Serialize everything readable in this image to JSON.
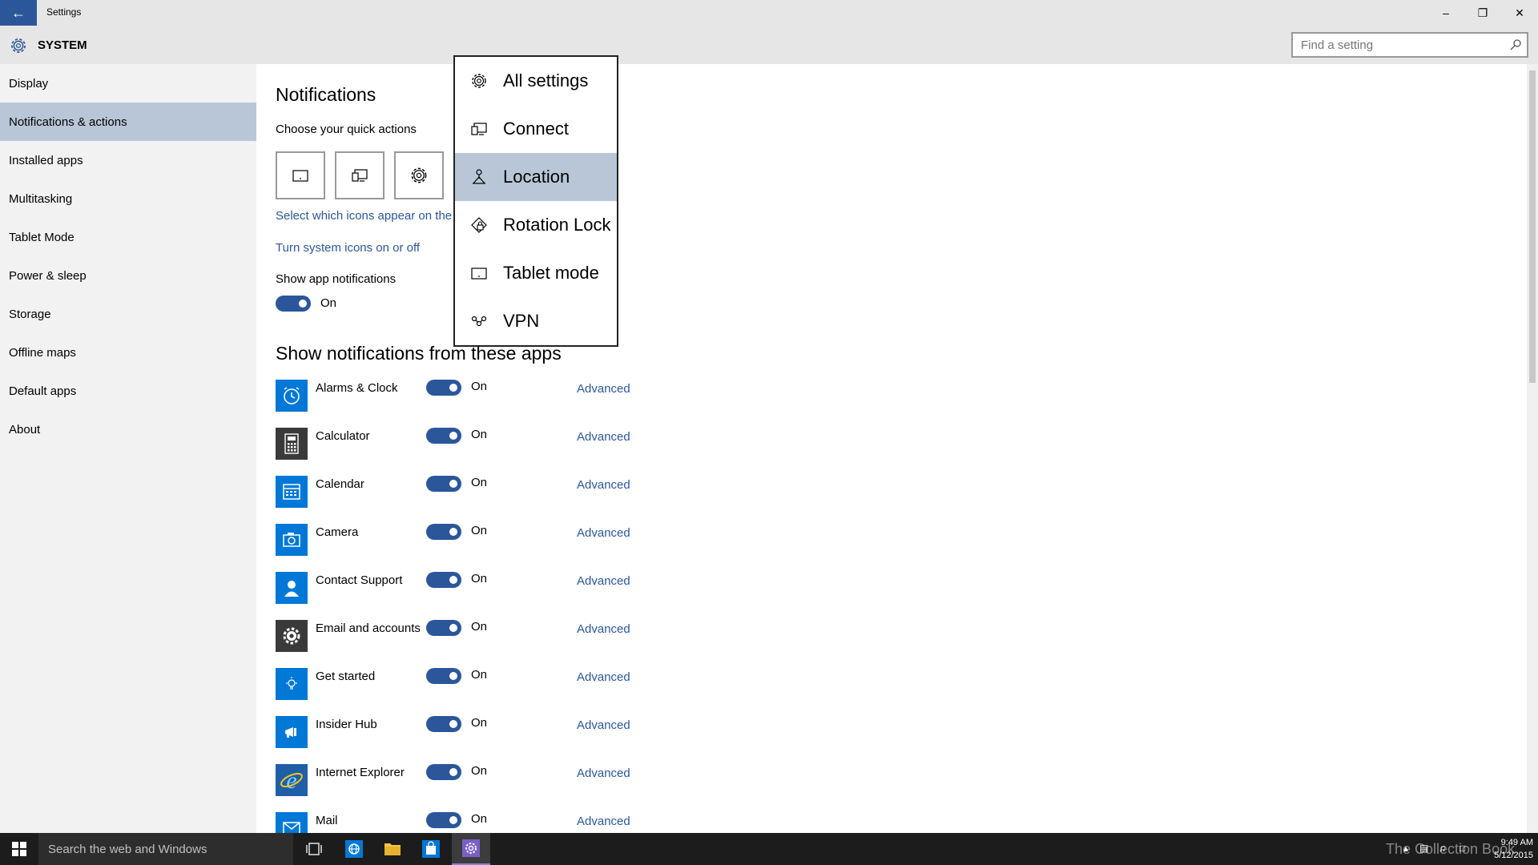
{
  "window": {
    "title": "Settings",
    "controls": {
      "minimize": "–",
      "restore": "❐",
      "close": "✕"
    }
  },
  "header": {
    "section": "SYSTEM",
    "search_placeholder": "Find a setting"
  },
  "sidebar": {
    "items": [
      {
        "label": "Display"
      },
      {
        "label": "Notifications & actions",
        "selected": true
      },
      {
        "label": "Installed apps"
      },
      {
        "label": "Multitasking"
      },
      {
        "label": "Tablet Mode"
      },
      {
        "label": "Power & sleep"
      },
      {
        "label": "Storage"
      },
      {
        "label": "Offline maps"
      },
      {
        "label": "Default apps"
      },
      {
        "label": "About"
      }
    ]
  },
  "main": {
    "title": "Notifications",
    "quick_actions_label": "Choose your quick actions",
    "quick_action_icons": [
      "tablet-icon",
      "connect-icon",
      "gear-icon"
    ],
    "select_icons_link": "Select which icons appear on the",
    "system_icons_link": "Turn system icons on or off",
    "show_app_notifications_label": "Show app notifications",
    "show_app_notifications_state": "On",
    "apps_header": "Show notifications from these apps",
    "apps": [
      {
        "name": "Alarms & Clock",
        "state": "On",
        "advanced": "Advanced",
        "icon": "alarm-clock-icon"
      },
      {
        "name": "Calculator",
        "state": "On",
        "advanced": "Advanced",
        "icon": "calculator-icon"
      },
      {
        "name": "Calendar",
        "state": "On",
        "advanced": "Advanced",
        "icon": "calendar-icon"
      },
      {
        "name": "Camera",
        "state": "On",
        "advanced": "Advanced",
        "icon": "camera-icon"
      },
      {
        "name": "Contact Support",
        "state": "On",
        "advanced": "Advanced",
        "icon": "contact-support-icon"
      },
      {
        "name": "Email and accounts",
        "state": "On",
        "advanced": "Advanced",
        "icon": "email-accounts-gear-icon"
      },
      {
        "name": "Get started",
        "state": "On",
        "advanced": "Advanced",
        "icon": "lightbulb-icon"
      },
      {
        "name": "Insider Hub",
        "state": "On",
        "advanced": "Advanced",
        "icon": "megaphone-icon"
      },
      {
        "name": "Internet Explorer",
        "state": "On",
        "advanced": "Advanced",
        "icon": "internet-explorer-icon"
      },
      {
        "name": "Mail",
        "state": "On",
        "advanced": "Advanced",
        "icon": "mail-icon"
      }
    ]
  },
  "menu": {
    "items": [
      {
        "label": "All settings",
        "icon": "gear-icon"
      },
      {
        "label": "Connect",
        "icon": "connect-icon"
      },
      {
        "label": "Location",
        "icon": "location-icon",
        "selected": true
      },
      {
        "label": "Rotation Lock",
        "icon": "rotation-lock-icon"
      },
      {
        "label": "Tablet mode",
        "icon": "tablet-icon"
      },
      {
        "label": "VPN",
        "icon": "vpn-icon"
      }
    ]
  },
  "taskbar": {
    "search_text": "Search the web and Windows",
    "watermark": "The Collection Book",
    "time": "9:49 AM",
    "date": "5/12/2015"
  },
  "colors": {
    "accent": "#2b579a",
    "selected_bg": "#b8c6d7",
    "app_tile": "#0078d7",
    "sidebar_bg": "#f2f2f2",
    "titlebar_bg": "#e6e6e6",
    "taskbar_bg": "#1c1c1c"
  }
}
